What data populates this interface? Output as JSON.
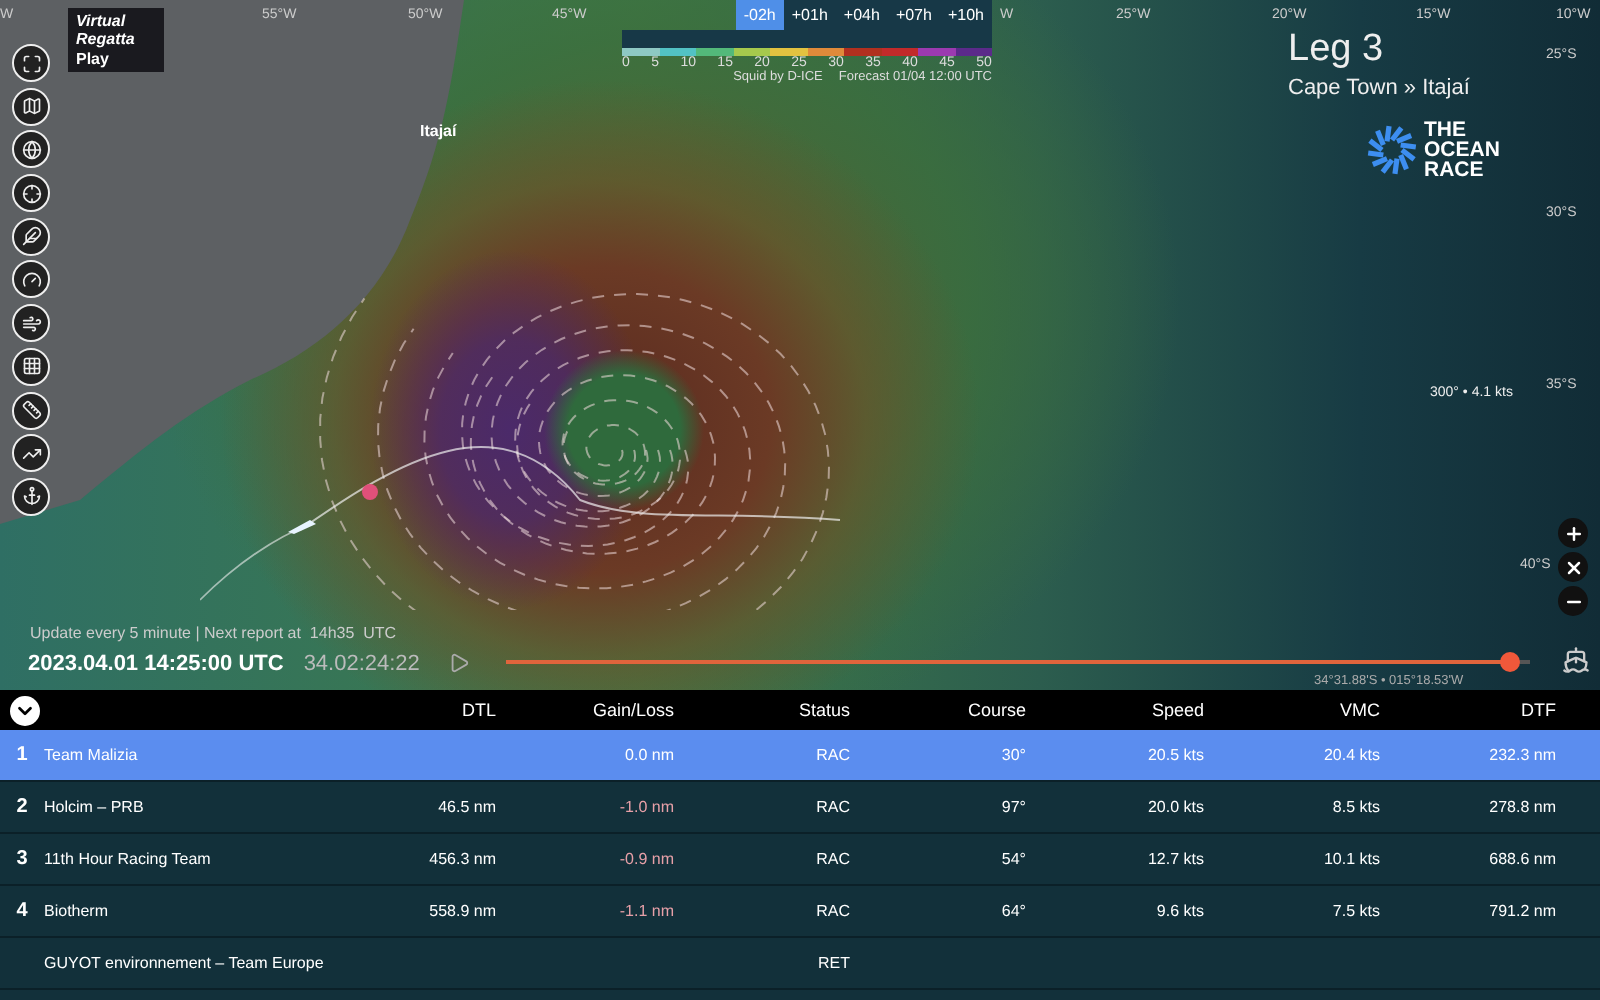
{
  "logo": {
    "line1": "Virtual",
    "line2": "Regatta",
    "action": "Play"
  },
  "forecast": {
    "steps": [
      {
        "label": "-02h",
        "selected": true
      },
      {
        "label": "+01h",
        "selected": false
      },
      {
        "label": "+04h",
        "selected": false
      },
      {
        "label": "+07h",
        "selected": false
      },
      {
        "label": "+10h",
        "selected": false
      }
    ],
    "scale": [
      "0",
      "5",
      "10",
      "15",
      "20",
      "25",
      "30",
      "35",
      "40",
      "45",
      "50"
    ],
    "credit": "Squid by D-ICE",
    "forecast_time": "Forecast 01/04 12:00 UTC"
  },
  "grid_labels": {
    "longitudes": [
      "W",
      "55°W",
      "50°W",
      "45°W",
      "W",
      "25°W",
      "20°W",
      "15°W",
      "10°W"
    ],
    "latitudes": [
      "25°S",
      "30°S",
      "35°S",
      "40°S"
    ]
  },
  "place_label": "Itajaí",
  "leg": {
    "title": "Leg 3",
    "route": "Cape Town » Itajaí"
  },
  "brand": [
    "THE",
    "OCEAN",
    "RACE"
  ],
  "wind_reading": "300° • 4.1 kts",
  "timeline": {
    "update_note": "Update every 5 minute | Next report at  14h35  UTC",
    "date": "2023.04.01 14:25:00 UTC",
    "elapsed": "34.02:24:22",
    "level": 0.98,
    "position": "34°31.88'S • 015°18.53'W"
  },
  "table": {
    "columns": [
      "DTL",
      "Gain/Loss",
      "Status",
      "Course",
      "Speed",
      "VMC",
      "DTF"
    ],
    "rows": [
      {
        "rank": "1",
        "name": "Team Malizia",
        "gain": "0.0 nm",
        "loss": false,
        "status": "RAC",
        "course": "30°",
        "speed": "20.5 kts",
        "vmc": "20.4 kts",
        "dtf": "232.3 nm",
        "selected": true
      },
      {
        "rank": "2",
        "name": "Holcim – PRB",
        "dtl": "46.5 nm",
        "gain": "-1.0 nm",
        "loss": true,
        "status": "RAC",
        "course": "97°",
        "speed": "20.0 kts",
        "vmc": "8.5 kts",
        "dtf": "278.8 nm",
        "selected": false
      },
      {
        "rank": "3",
        "name": "11th Hour Racing Team",
        "dtl": "456.3 nm",
        "gain": "-0.9 nm",
        "loss": true,
        "status": "RAC",
        "course": "54°",
        "speed": "12.7 kts",
        "vmc": "10.1 kts",
        "dtf": "688.6 nm",
        "selected": false
      },
      {
        "rank": "4",
        "name": "Biotherm",
        "dtl": "558.9 nm",
        "gain": "-1.1 nm",
        "loss": true,
        "status": "RAC",
        "course": "64°",
        "speed": "9.6 kts",
        "vmc": "7.5 kts",
        "dtf": "791.2 nm",
        "selected": false
      },
      {
        "name": "GUYOT environnement – Team Europe",
        "status": "RET",
        "selected": false
      }
    ]
  }
}
